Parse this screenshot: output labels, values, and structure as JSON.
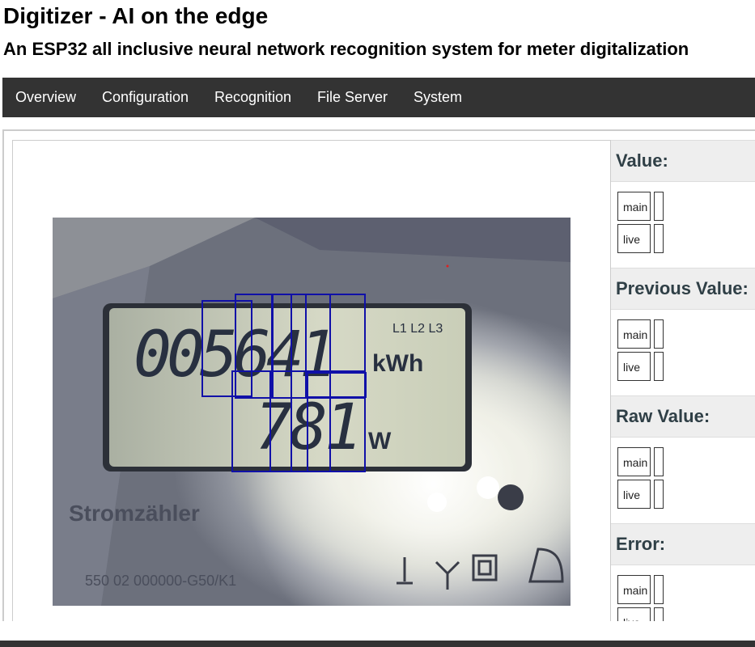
{
  "header": {
    "title": "Digitizer - AI on the edge",
    "subtitle": "An ESP32 all inclusive neural network recognition system for meter digitalization"
  },
  "nav": {
    "items": [
      {
        "label": "Overview"
      },
      {
        "label": "Configuration"
      },
      {
        "label": "Recognition"
      },
      {
        "label": "File Server"
      },
      {
        "label": "System"
      }
    ]
  },
  "meter_image": {
    "lcd_top_digits": "005641",
    "lcd_top_unit": "kWh",
    "lcd_bottom_digits": "781",
    "lcd_bottom_unit": "W",
    "phase_indicator": "L1 L2 L3",
    "plate_text": "Stromzähler",
    "model_text": "550 02 000000-G50/K1",
    "colors": {
      "roi_box": "#1010a8",
      "lcd": "#c9ceb8",
      "lcd_digits": "#283040"
    }
  },
  "values": {
    "sections": [
      {
        "title": "Value:",
        "rows": [
          {
            "label": "main",
            "value": ""
          },
          {
            "label": "live",
            "value": ""
          }
        ]
      },
      {
        "title": "Previous Value:",
        "rows": [
          {
            "label": "main",
            "value": ""
          },
          {
            "label": "live",
            "value": ""
          }
        ]
      },
      {
        "title": "Raw Value:",
        "rows": [
          {
            "label": "main",
            "value": ""
          },
          {
            "label": "live",
            "value": ""
          }
        ]
      },
      {
        "title": "Error:",
        "rows": [
          {
            "label": "main",
            "value": ""
          },
          {
            "label": "live",
            "value": ""
          }
        ]
      }
    ]
  }
}
